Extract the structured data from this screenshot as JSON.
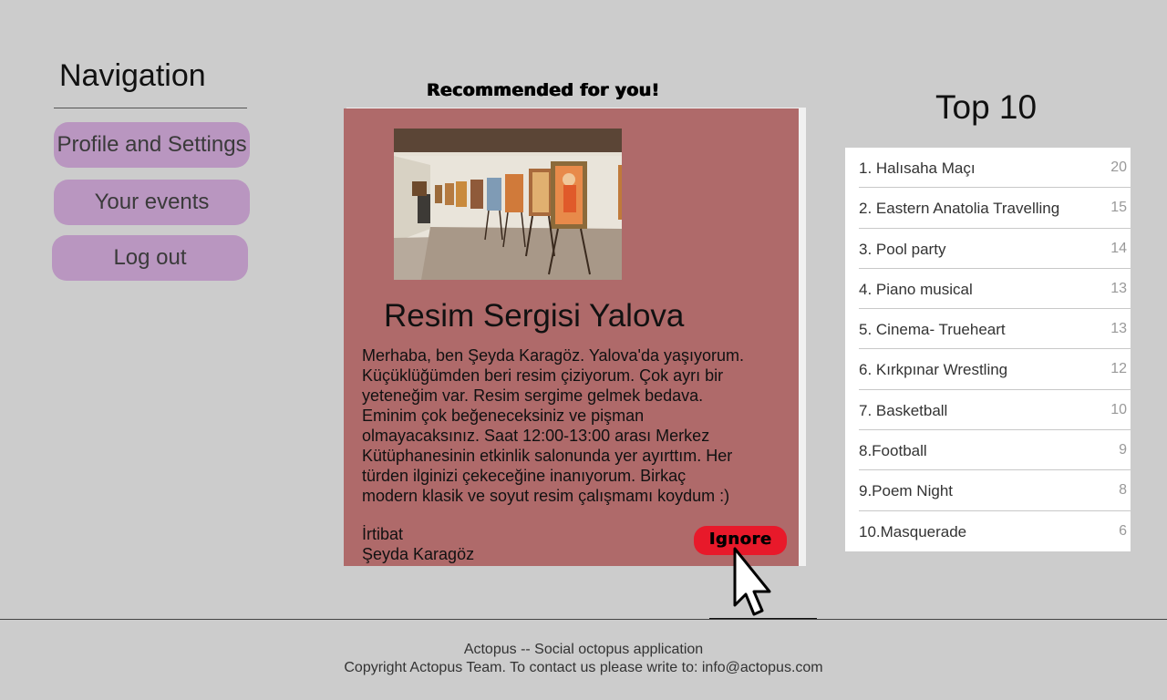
{
  "navigation": {
    "title": "Navigation",
    "items": [
      {
        "label": "Profile and Settings"
      },
      {
        "label": "Your events"
      },
      {
        "label": "Log out"
      }
    ]
  },
  "recommended": {
    "heading": "Recommended for you!",
    "event_title": "Resim Sergisi Yalova",
    "description": "Merhaba, ben Şeyda Karagöz. Yalova'da yaşıyorum. Küçüklüğümden beri resim çiziyorum. Çok ayrı bir yeteneğim var. Resim sergime gelmek bedava. Eminim çok beğeneceksiniz ve pişman olmayacaksınız. Saat 12:00-13:00 arası Merkez Kütüphanesinin etkinlik salonunda yer ayırttım. Her türden ilginizi çekeceğine inanıyorum. Birkaç modern klasik ve soyut resim çalışmamı koydum :)",
    "contact_label": "İrtibat",
    "contact_name": "Şeyda Karagöz",
    "ignore_label": "Ignore",
    "ignore_color": "#e8192a",
    "card_color": "#af6a6a"
  },
  "top10": {
    "title": "Top 10",
    "items": [
      {
        "name": "1. Halısaha Maçı",
        "count": "20"
      },
      {
        "name": "2. Eastern Anatolia Travelling",
        "count": "15"
      },
      {
        "name": "3. Pool party",
        "count": "14"
      },
      {
        "name": "4. Piano musical",
        "count": "13"
      },
      {
        "name": "5. Cinema- Trueheart",
        "count": "13"
      },
      {
        "name": "6. Kırkpınar Wrestling",
        "count": "12"
      },
      {
        "name": "7. Basketball",
        "count": "10"
      },
      {
        "name": "8.Football",
        "count": "9"
      },
      {
        "name": "9.Poem Night",
        "count": "8"
      },
      {
        "name": "10.Masquerade",
        "count": "6"
      }
    ]
  },
  "footer": {
    "line1": "Actopus -- Social octopus application",
    "line2": "Copyright Actopus Team. To contact us please write to: info@actopus.com"
  }
}
